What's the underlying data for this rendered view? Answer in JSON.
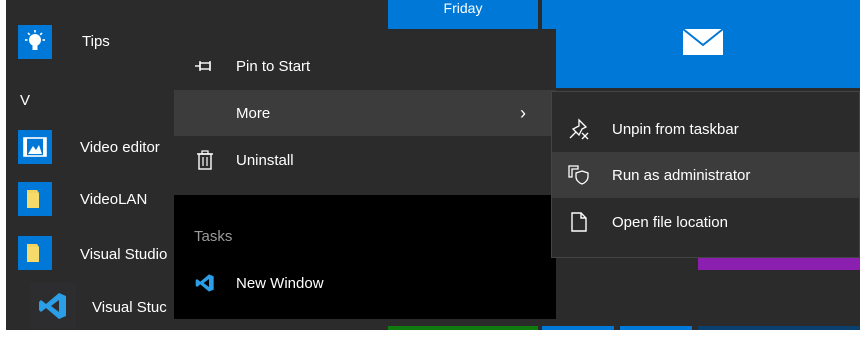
{
  "start_menu": {
    "group_letter": "V",
    "apps": [
      {
        "label": "Tips",
        "icon": "lightbulb-icon",
        "icon_bg": "#0078d7"
      },
      {
        "label": "Video editor",
        "icon": "video-editor-icon",
        "icon_bg": "#0078d7"
      },
      {
        "label": "VideoLAN",
        "icon": "folder-icon",
        "icon_bg": "#0078d7"
      },
      {
        "label": "Visual Studio",
        "icon": "folder-icon",
        "icon_bg": "#0078d7"
      },
      {
        "label": "Visual Stuc",
        "icon": "vscode-icon",
        "icon_bg": "#2d2d30"
      }
    ],
    "tiles": {
      "calendar_day": "Friday",
      "calendar_color": "#0078d7",
      "mail_color": "#0078d7",
      "mail_icon": "mail-icon"
    }
  },
  "context_menu": {
    "items": [
      {
        "label": "Pin to Start",
        "icon": "pin-icon"
      },
      {
        "label": "More",
        "icon": "",
        "chevron": "›"
      },
      {
        "label": "Uninstall",
        "icon": "trash-icon"
      }
    ],
    "section_label": "Tasks",
    "tasks": [
      {
        "label": "New Window",
        "icon": "vscode-icon"
      }
    ]
  },
  "submenu": {
    "items": [
      {
        "label": "Unpin from taskbar",
        "icon": "unpin-icon"
      },
      {
        "label": "Run as administrator",
        "icon": "run-as-admin-icon"
      },
      {
        "label": "Open file location",
        "icon": "file-icon"
      }
    ]
  },
  "colors": {
    "accent": "#0078d7",
    "menu_bg": "#2b2b2b",
    "menu_highlight": "#3c3c3c",
    "tile_purple": "#8a1fb0",
    "tile_green": "#107c10"
  }
}
